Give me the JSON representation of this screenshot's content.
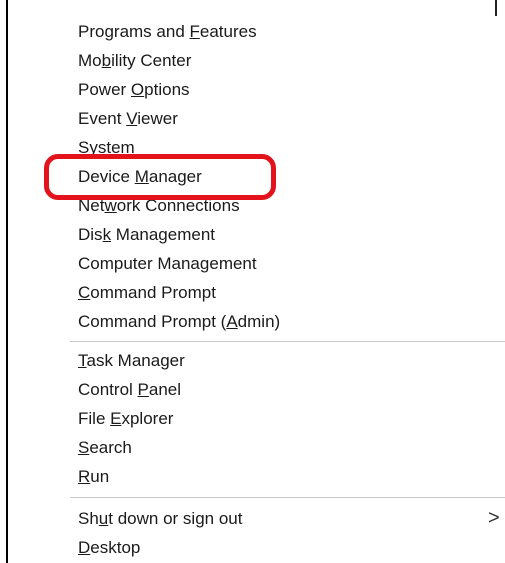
{
  "menu": {
    "group1": [
      {
        "pre": "Programs and ",
        "acc": "F",
        "post": "eatures"
      },
      {
        "pre": "Mo",
        "acc": "b",
        "post": "ility Center"
      },
      {
        "pre": "Power ",
        "acc": "O",
        "post": "ptions"
      },
      {
        "pre": "Event ",
        "acc": "V",
        "post": "iewer"
      },
      {
        "pre": "S",
        "acc": "y",
        "post": "stem"
      },
      {
        "pre": "Device ",
        "acc": "M",
        "post": "anager"
      },
      {
        "pre": "Net",
        "acc": "w",
        "post": "ork Connections"
      },
      {
        "pre": "Dis",
        "acc": "k",
        "post": " Management"
      },
      {
        "pre": "Computer Mana",
        "acc": "g",
        "post": "ement"
      },
      {
        "pre": "",
        "acc": "C",
        "post": "ommand Prompt"
      },
      {
        "pre": "Command Prompt (",
        "acc": "A",
        "post": "dmin)"
      }
    ],
    "group2": [
      {
        "pre": "",
        "acc": "T",
        "post": "ask Manager"
      },
      {
        "pre": "Control ",
        "acc": "P",
        "post": "anel"
      },
      {
        "pre": "File ",
        "acc": "E",
        "post": "xplorer"
      },
      {
        "pre": "",
        "acc": "S",
        "post": "earch"
      },
      {
        "pre": "",
        "acc": "R",
        "post": "un"
      }
    ],
    "group3": [
      {
        "pre": "Sh",
        "acc": "u",
        "post": "t down or sign out"
      },
      {
        "pre": "",
        "acc": "D",
        "post": "esktop"
      }
    ],
    "submenu_arrow": ">"
  },
  "annotation": {
    "highlighted_item": "Device Manager",
    "color": "#e3121b"
  }
}
